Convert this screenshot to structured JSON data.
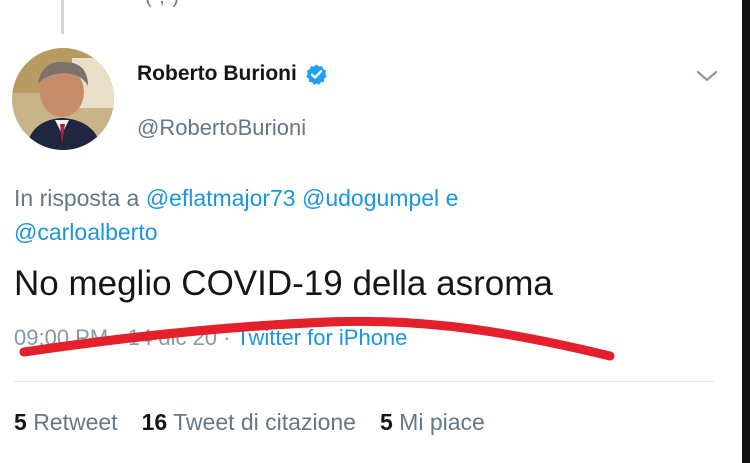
{
  "header_fragment": "( , )",
  "author": {
    "name": "Roberto Burioni",
    "handle": "@RobertoBurioni",
    "verified_icon": "verified-badge-icon",
    "caret_icon": "chevron-down-icon"
  },
  "reply": {
    "prefix": "In risposta a",
    "mention_1": "@eflatmajor73",
    "mention_2": "@udogumpel",
    "conjunction": "e",
    "mention_3": "@carloalberto"
  },
  "tweet": {
    "text": "No meglio COVID-19 della asroma"
  },
  "meta": {
    "time": "09:00 PM",
    "separator": "·",
    "date": "14 dic 20",
    "source": "Twitter for iPhone"
  },
  "stats": {
    "retweets_count": "5",
    "retweets_label": "Retweet",
    "quotes_count": "16",
    "quotes_label": "Tweet di citazione",
    "likes_count": "5",
    "likes_label": "Mi piace"
  },
  "colors": {
    "link": "#1b95e0",
    "secondary": "#657786",
    "scribble": "#e3202b"
  }
}
